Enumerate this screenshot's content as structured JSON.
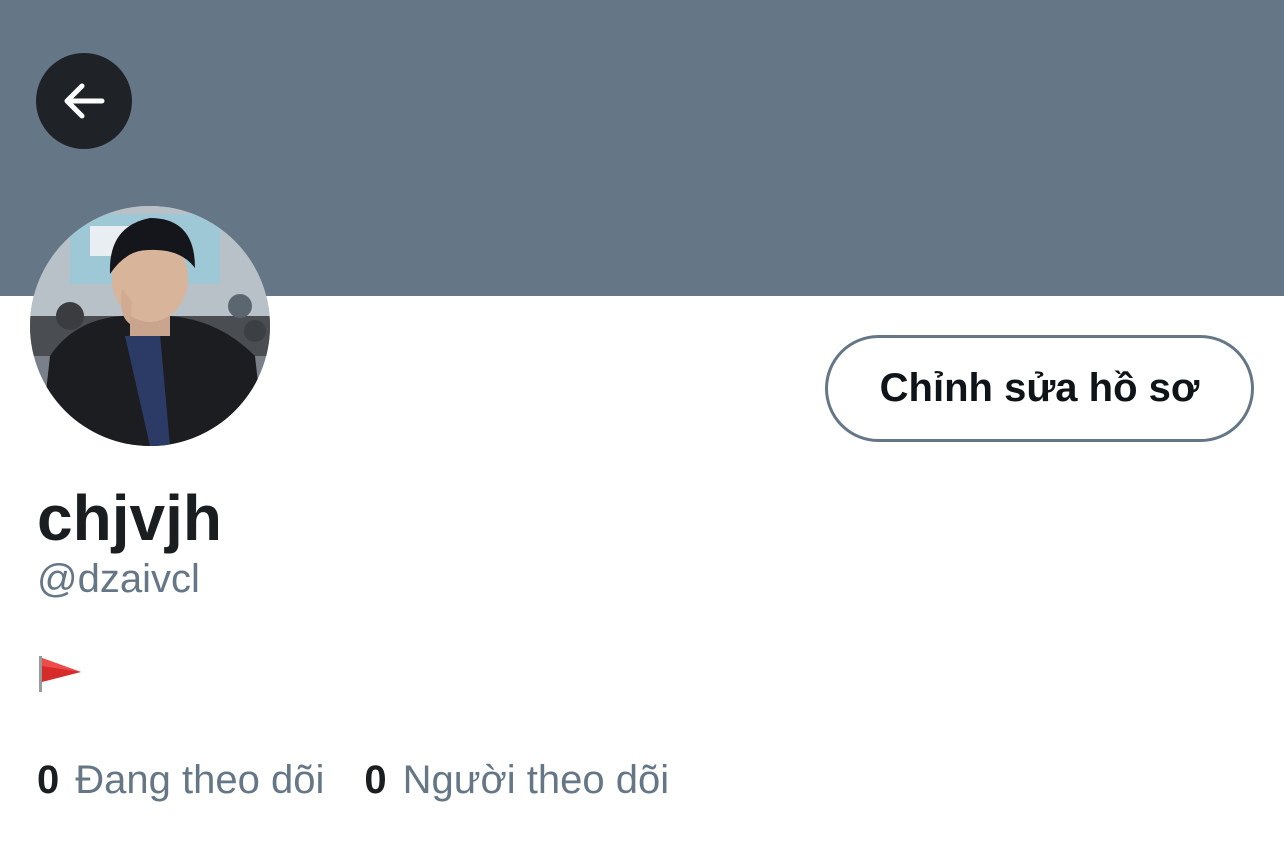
{
  "colors": {
    "banner": "#657786",
    "secondary_text": "#657786",
    "primary_text": "#1b1e21",
    "back_button_bg": "#1f2327"
  },
  "header": {
    "back_icon": "arrow-left-icon"
  },
  "profile": {
    "avatar": "profile-photo",
    "edit_button_label": "Chỉnh sửa hồ sơ",
    "display_name": "chjvjh",
    "handle": "@dzaivcl",
    "bio_icon": "red-triangular-flag-icon"
  },
  "stats": {
    "following": {
      "count": "0",
      "label": "Đang theo dõi"
    },
    "followers": {
      "count": "0",
      "label": "Người theo dõi"
    }
  }
}
